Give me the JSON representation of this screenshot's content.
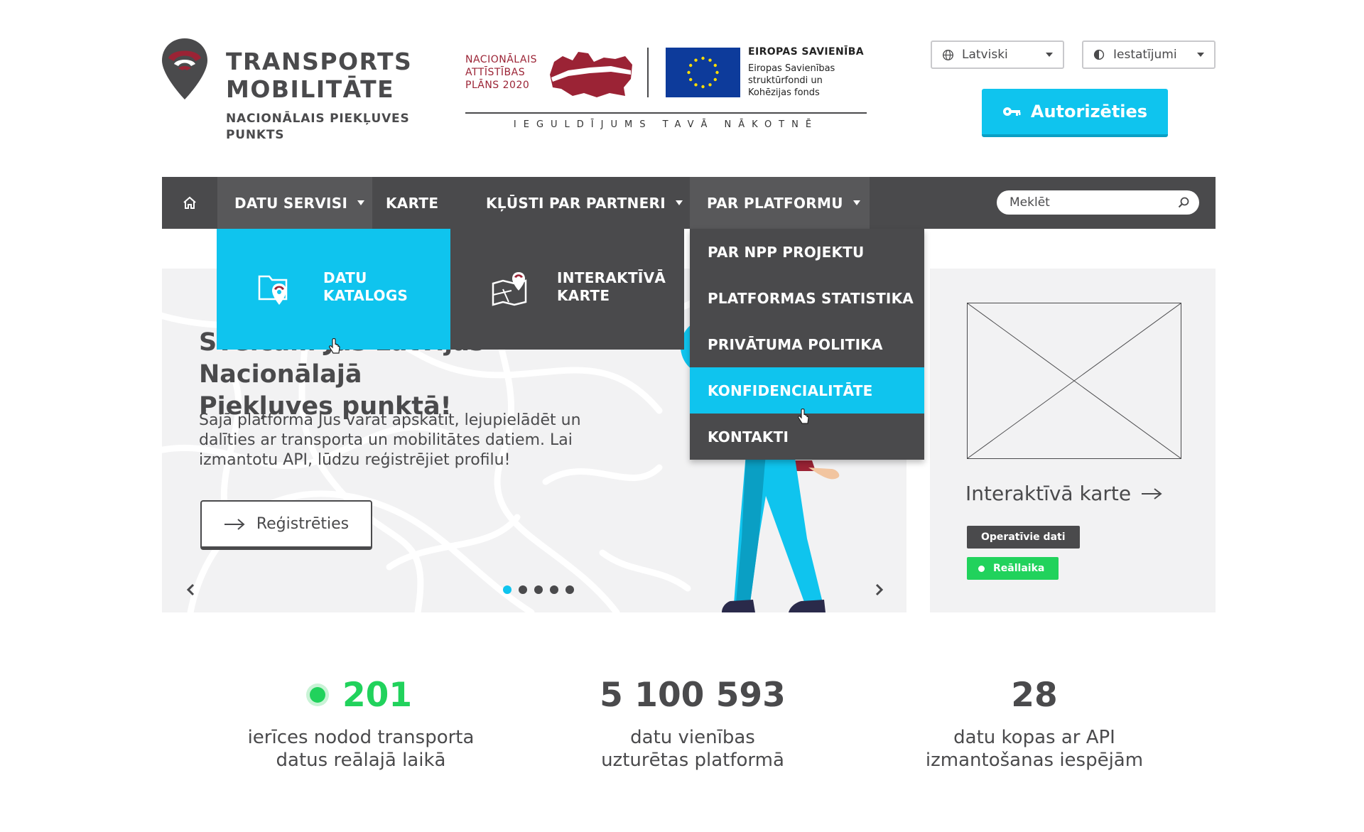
{
  "logo": {
    "title_line1": "TRANSPORTS",
    "title_line2": "MOBILITĀTE",
    "subtitle_line1": "NACIONĀLAIS PIEKĻUVES",
    "subtitle_line2": "PUNKTS"
  },
  "partners": {
    "nap_line1": "NACIONĀLAIS",
    "nap_line2": "ATTĪSTĪBAS",
    "nap_line3": "PLĀNS 2020",
    "eu_title": "EIROPAS SAVIENĪBA",
    "eu_line1": "Eiropas Savienības",
    "eu_line2": "struktūrfondi un",
    "eu_line3": "Kohēzijas fonds",
    "motto": "IEGULDĪJUMS TAVĀ NĀKOTNĒ"
  },
  "header": {
    "language": "Latviski",
    "settings": "Iestatījumi",
    "auth_button": "Autorizēties"
  },
  "nav": {
    "items": [
      {
        "label": "DATU SERVISI"
      },
      {
        "label": "KARTE"
      },
      {
        "label": "KĻŪSTI PAR PARTNERI"
      },
      {
        "label": "PAR PLATFORMU"
      }
    ],
    "search_placeholder": "Meklēt"
  },
  "datu_dropdown": {
    "katalogs_line1": "DATU",
    "katalogs_line2": "KATALOGS",
    "karte_line1": "INTERAKTĪVĀ",
    "karte_line2": "KARTE"
  },
  "par_dropdown": {
    "items": [
      {
        "label": "PAR NPP PROJEKTU"
      },
      {
        "label": "PLATFORMAS STATISTIKA"
      },
      {
        "label": "PRIVĀTUMA POLITIKA"
      },
      {
        "label": "KONFIDENCIALITĀTE"
      },
      {
        "label": "KONTAKTI"
      }
    ],
    "active_index": 3
  },
  "hero": {
    "title_line1": "Sveicam Jūs Latvijas Nacionālajā",
    "title_line2": "Piekļuves punktā!",
    "text": "Šajā platformā Jūs varat apskatīt, lejupielādēt un dalīties ar transporta un mobilitātes datiem. Lai izmantotu API, lūdzu reģistrējiet profilu!",
    "register_button": "Reģistrēties",
    "slide_count": 5,
    "active_slide": 1
  },
  "side_card": {
    "title": "Interaktīvā karte",
    "tag_operational": "Operatīvie dati",
    "tag_realtime": "Reāllaika"
  },
  "stats": [
    {
      "value": "201",
      "label_line1": "ierīces nodod transporta",
      "label_line2": "datus reālajā laikā"
    },
    {
      "value": "5 100 593",
      "label_line1": "datu vienības",
      "label_line2": "uzturētas platformā"
    },
    {
      "value": "28",
      "label_line1": "datu kopas ar API",
      "label_line2": "izmantošanas iespējām"
    }
  ],
  "colors": {
    "accent": "#0fc4ee",
    "nav_dark": "#4a4a4c",
    "green": "#21d25c",
    "brand_red": "#9b2335"
  }
}
